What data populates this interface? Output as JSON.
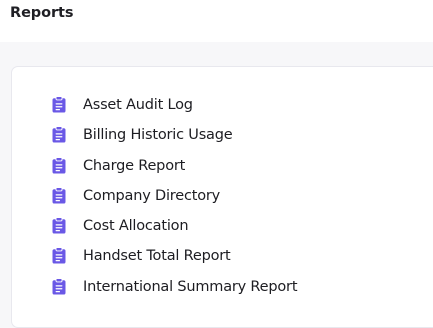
{
  "header": {
    "title": "Reports"
  },
  "colors": {
    "icon": "#6a58e6",
    "text": "#1d1d22",
    "page_bg": "#f7f7f9",
    "card_bg": "#ffffff"
  },
  "reports": {
    "icon_name": "clipboard-icon",
    "items": [
      {
        "label": "Asset Audit Log"
      },
      {
        "label": "Billing Historic Usage"
      },
      {
        "label": "Charge Report"
      },
      {
        "label": "Company Directory"
      },
      {
        "label": "Cost Allocation"
      },
      {
        "label": "Handset Total Report"
      },
      {
        "label": "International Summary Report"
      }
    ]
  }
}
